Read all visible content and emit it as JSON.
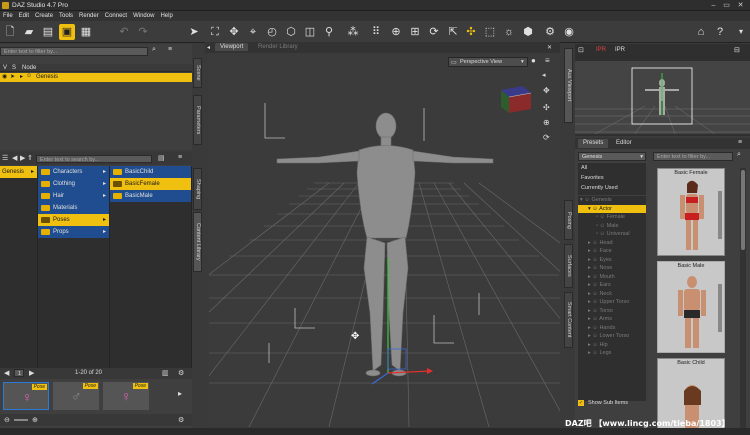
{
  "window": {
    "title": "DAZ Studio 4.7 Pro"
  },
  "menu": [
    "File",
    "Edit",
    "Create",
    "Tools",
    "Render",
    "Connect",
    "Window",
    "Help"
  ],
  "scene_panel": {
    "filter_placeholder": "Enter text to filter by...",
    "columns": [
      "V",
      "S",
      "Node"
    ],
    "nodes": [
      {
        "label": "Genesis",
        "selected": true
      }
    ],
    "side_tabs": [
      "Scene",
      "Parameters"
    ]
  },
  "content_library": {
    "search_placeholder": "Enter text to search by...",
    "side_tabs": [
      "Shaping",
      "Content Library"
    ],
    "col1": [
      {
        "label": "Genesis",
        "selected": true
      }
    ],
    "col2": [
      {
        "label": "Characters"
      },
      {
        "label": "Clothing"
      },
      {
        "label": "Hair"
      },
      {
        "label": "Materials"
      },
      {
        "label": "Poses",
        "selected": true
      },
      {
        "label": "Props"
      }
    ],
    "col3": [
      {
        "label": "BasicChild"
      },
      {
        "label": "BasicFemale",
        "selected": true
      },
      {
        "label": "BasicMale"
      }
    ],
    "pagination": "1-20 of 20",
    "page": "1",
    "thumb_badge": "Pose"
  },
  "viewport": {
    "tabs": [
      "Viewport",
      "Render Library"
    ],
    "camera": "Perspective View"
  },
  "aux_viewport": {
    "tab": "Aux Viewport",
    "buttons": [
      "IPR",
      "IPR"
    ]
  },
  "smart_content": {
    "tabs": [
      "Presets",
      "Editor"
    ],
    "figure": "Genesis",
    "filter_placeholder": "Enter text to filter by...",
    "categories": [
      "All",
      "Favorites",
      "Currently Used"
    ],
    "side_tabs": [
      "Posing",
      "Surfaces",
      "Smart Content"
    ],
    "tree": [
      {
        "label": "Genesis",
        "indent": 0,
        "dim": true
      },
      {
        "label": "Actor",
        "indent": 1,
        "selected": true
      },
      {
        "label": "Female",
        "indent": 2,
        "dim": true
      },
      {
        "label": "Male",
        "indent": 2,
        "dim": true
      },
      {
        "label": "Universal",
        "indent": 2,
        "dim": true
      },
      {
        "label": "Head",
        "indent": 1,
        "dim": true
      },
      {
        "label": "Face",
        "indent": 1,
        "dim": true
      },
      {
        "label": "Eyes",
        "indent": 1,
        "dim": true
      },
      {
        "label": "Nose",
        "indent": 1,
        "dim": true
      },
      {
        "label": "Mouth",
        "indent": 1,
        "dim": true
      },
      {
        "label": "Ears",
        "indent": 1,
        "dim": true
      },
      {
        "label": "Neck",
        "indent": 1,
        "dim": true
      },
      {
        "label": "Upper Torso",
        "indent": 1,
        "dim": true
      },
      {
        "label": "Torso",
        "indent": 1,
        "dim": true
      },
      {
        "label": "Arms",
        "indent": 1,
        "dim": true
      },
      {
        "label": "Hands",
        "indent": 1,
        "dim": true
      },
      {
        "label": "Lower Torso",
        "indent": 1,
        "dim": true
      },
      {
        "label": "Hip",
        "indent": 1,
        "dim": true
      },
      {
        "label": "Legs",
        "indent": 1,
        "dim": true
      }
    ],
    "show_sub_items": "Show Sub Items",
    "presets": [
      "Basic Female",
      "Basic Male",
      "Basic Child"
    ]
  },
  "watermark": "DAZ吧 【www.lincg.com/tieba/1803】",
  "colors": {
    "accent": "#f0c010",
    "selection_blue": "#1f4d8f",
    "panel": "#3f3f3f",
    "viewport_bg": "#3b3b3b"
  }
}
